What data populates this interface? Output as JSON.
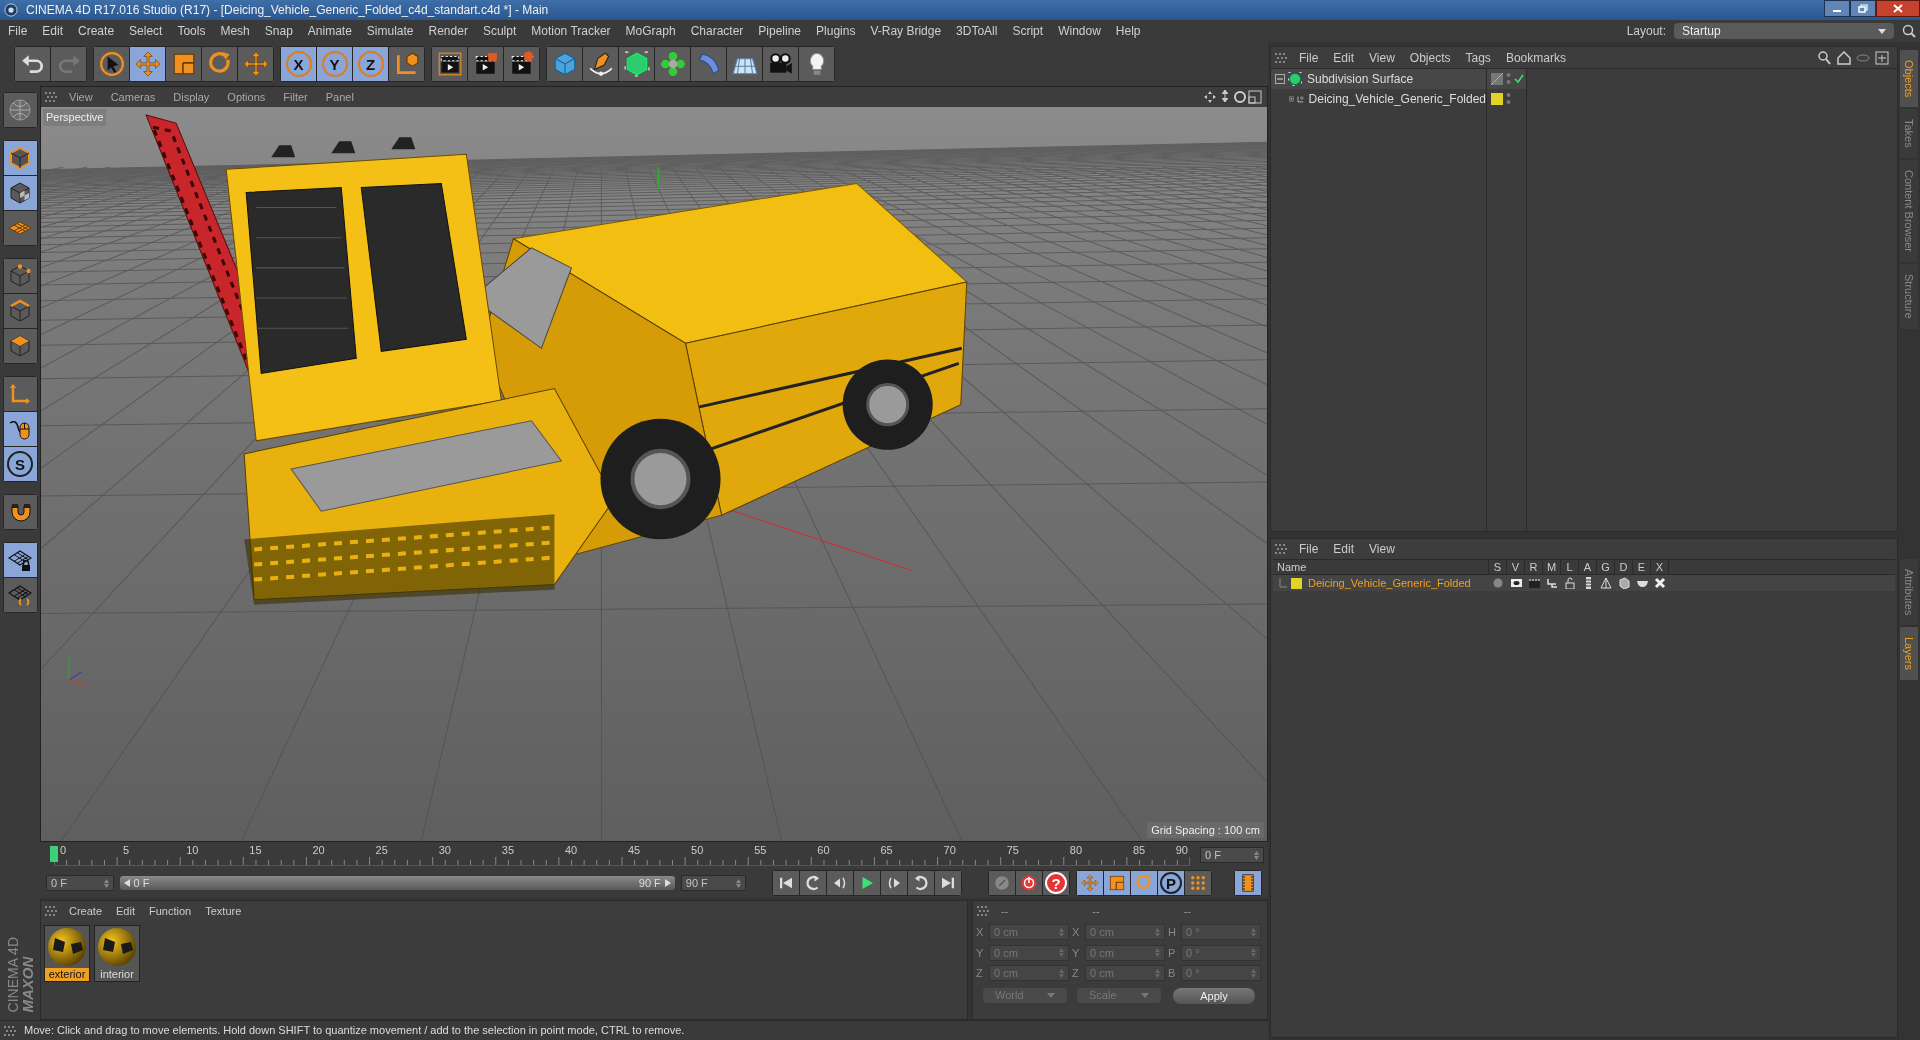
{
  "window": {
    "title": "CINEMA 4D R17.016 Studio (R17) - [Deicing_Vehicle_Generic_Folded_c4d_standart.c4d *] - Main"
  },
  "menu": [
    "File",
    "Edit",
    "Create",
    "Select",
    "Tools",
    "Mesh",
    "Snap",
    "Animate",
    "Simulate",
    "Render",
    "Sculpt",
    "Motion Tracker",
    "MoGraph",
    "Character",
    "Pipeline",
    "Plugins",
    "V-Ray Bridge",
    "3DToAll",
    "Script",
    "Window",
    "Help"
  ],
  "layout": {
    "label": "Layout:",
    "value": "Startup"
  },
  "toolbar": [
    [
      {
        "kind": "undo",
        "selected": false
      },
      {
        "kind": "redo",
        "selected": false
      }
    ],
    [
      {
        "kind": "select",
        "selected": false
      },
      {
        "kind": "move",
        "selected": true
      },
      {
        "kind": "scale",
        "selected": false
      },
      {
        "kind": "rotate",
        "selected": false
      },
      {
        "kind": "transform",
        "selected": false
      }
    ],
    [
      {
        "kind": "axis",
        "label": "X",
        "selected": true
      },
      {
        "kind": "axis",
        "label": "Y",
        "selected": true
      },
      {
        "kind": "axis",
        "label": "Z",
        "selected": true
      },
      {
        "kind": "coord",
        "selected": false
      }
    ],
    [
      {
        "kind": "render-view",
        "selected": false
      },
      {
        "kind": "render",
        "selected": false
      },
      {
        "kind": "render-settings",
        "selected": false
      }
    ],
    [
      {
        "kind": "cube",
        "selected": false
      },
      {
        "kind": "pen",
        "selected": false
      },
      {
        "kind": "subdivide",
        "selected": false
      },
      {
        "kind": "cloner",
        "selected": false
      },
      {
        "kind": "deformer",
        "selected": false
      },
      {
        "kind": "floor",
        "selected": false
      },
      {
        "kind": "camera",
        "selected": false
      },
      {
        "kind": "light",
        "selected": false
      }
    ]
  ],
  "left_toolbar": [
    [
      {
        "kind": "model",
        "selected": false
      }
    ],
    [
      {
        "kind": "object-mode",
        "selected": true
      },
      {
        "kind": "texture",
        "selected": true
      },
      {
        "kind": "workplane",
        "selected": false
      }
    ],
    [
      {
        "kind": "points",
        "selected": false
      },
      {
        "kind": "edges",
        "selected": false
      },
      {
        "kind": "polygons",
        "selected": false
      }
    ],
    [
      {
        "kind": "axis-mode",
        "selected": false
      },
      {
        "kind": "tweak",
        "selected": true
      },
      {
        "kind": "snap",
        "label": "S",
        "selected": true
      }
    ],
    [
      {
        "kind": "magnet",
        "selected": false
      }
    ],
    [
      {
        "kind": "grid-lock",
        "selected": true
      },
      {
        "kind": "grid-refresh",
        "selected": false
      }
    ]
  ],
  "logo": {
    "brand": "MAXON",
    "product": "CINEMA 4D"
  },
  "viewport": {
    "menu": [
      "View",
      "Cameras",
      "Display",
      "Options",
      "Filter",
      "Panel"
    ],
    "camera": "Perspective",
    "grid_spacing": "Grid Spacing : 100 cm"
  },
  "timeline": {
    "ticks": [
      "0",
      "5",
      "10",
      "15",
      "20",
      "25",
      "30",
      "35",
      "40",
      "45",
      "50",
      "55",
      "60",
      "65",
      "70",
      "75",
      "80",
      "85",
      "90"
    ],
    "playhead": {
      "level": 0
    },
    "frame_field": "0 F",
    "start_field": "0 F",
    "range": {
      "start": "0 F",
      "end": "90 F",
      "level": 1
    },
    "end_field": "90 F",
    "transport": [
      [
        {
          "kind": "first",
          "selected": false
        },
        {
          "kind": "prev-key",
          "selected": false
        },
        {
          "kind": "prev-frame",
          "selected": false
        },
        {
          "kind": "play",
          "selected": false
        },
        {
          "kind": "next-frame",
          "selected": false
        },
        {
          "kind": "next-key",
          "selected": false
        },
        {
          "kind": "last",
          "selected": false
        }
      ],
      [
        {
          "kind": "record-off",
          "selected": false
        },
        {
          "kind": "record",
          "selected": false
        },
        {
          "kind": "autokey",
          "label": "?",
          "selected": false
        }
      ],
      [
        {
          "kind": "move",
          "selected": true
        },
        {
          "kind": "scale",
          "selected": true
        },
        {
          "kind": "rotate",
          "selected": true
        },
        {
          "kind": "param",
          "label": "P",
          "selected": true
        },
        {
          "kind": "dots",
          "selected": false
        }
      ],
      [
        {
          "kind": "timeline",
          "selected": true
        }
      ]
    ]
  },
  "materials": {
    "menu": [
      "Create",
      "Edit",
      "Function",
      "Texture"
    ],
    "items": [
      {
        "name": "exterior",
        "selected": true
      },
      {
        "name": "interior",
        "selected": false
      }
    ]
  },
  "coordinates": {
    "headers": [
      "--",
      "--",
      "--"
    ],
    "rows": [
      {
        "position_axis": "X",
        "position": "0 cm",
        "size_axis": "X",
        "size": "0 cm",
        "rotation_axis": "H",
        "rotation": "0 °"
      },
      {
        "position_axis": "Y",
        "position": "0 cm",
        "size_axis": "Y",
        "size": "0 cm",
        "rotation_axis": "P",
        "rotation": "0 °"
      },
      {
        "position_axis": "Z",
        "position": "0 cm",
        "size_axis": "Z",
        "size": "0 cm",
        "rotation_axis": "B",
        "rotation": "0 °"
      }
    ],
    "mode": "World",
    "size_mode": "Scale",
    "apply": "Apply"
  },
  "status_bar": "Move: Click and drag to move elements. Hold down SHIFT to quantize movement / add to the selection in point mode, CTRL to remove.",
  "object_manager": {
    "menu": [
      "File",
      "Edit",
      "View",
      "Objects",
      "Tags",
      "Bookmarks"
    ],
    "objects": [
      {
        "name": "Subdivision Surface",
        "kind": "subdivision",
        "expanded": true,
        "enabled": true,
        "children": [
          {
            "name": "Deicing_Vehicle_Generic_Folded",
            "kind": "null",
            "expanded": false,
            "color": "#e2d424"
          }
        ]
      }
    ]
  },
  "layer_manager": {
    "menu": [
      "File",
      "Edit",
      "View"
    ],
    "columns": [
      "Name",
      "S",
      "V",
      "R",
      "M",
      "L",
      "A",
      "G",
      "D",
      "E",
      "X"
    ],
    "layers": [
      {
        "name": "Deicing_Vehicle_Generic_Folded",
        "color": "#e2d424"
      }
    ]
  },
  "side_tabs": [
    {
      "label": "Objects",
      "selected": true
    },
    {
      "label": "Takes",
      "selected": false
    },
    {
      "label": "Content Browser",
      "selected": false
    },
    {
      "label": "Structure",
      "selected": false
    }
  ],
  "side_tabs_lower": [
    {
      "label": "Attributes",
      "selected": false
    },
    {
      "label": "Layers",
      "selected": true
    }
  ]
}
